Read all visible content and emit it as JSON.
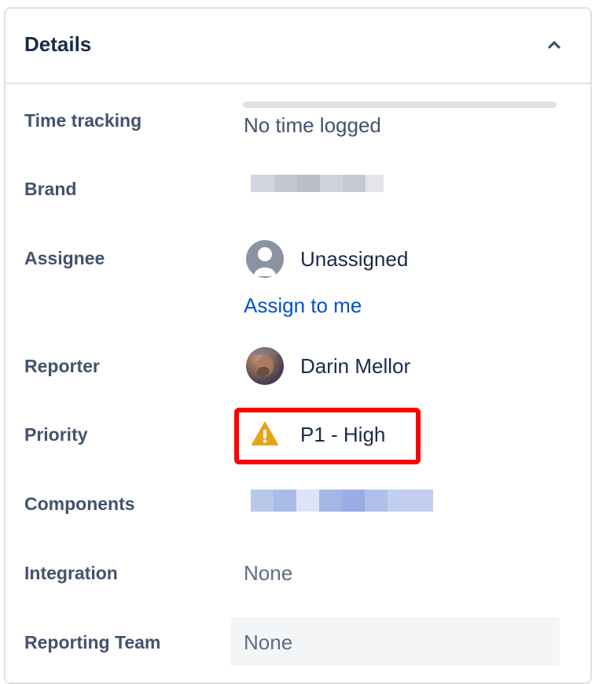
{
  "panel": {
    "title": "Details"
  },
  "fields": {
    "time_tracking": {
      "label": "Time tracking",
      "value": "No time logged"
    },
    "brand": {
      "label": "Brand"
    },
    "assignee": {
      "label": "Assignee",
      "value": "Unassigned",
      "action": "Assign to me"
    },
    "reporter": {
      "label": "Reporter",
      "value": "Darin Mellor"
    },
    "priority": {
      "label": "Priority",
      "value": "P1 - High"
    },
    "components": {
      "label": "Components"
    },
    "integration": {
      "label": "Integration",
      "value": "None"
    },
    "reporting_team": {
      "label": "Reporting Team",
      "value": "None"
    }
  },
  "colors": {
    "link": "#0052cc",
    "highlight": "#ff0000",
    "warning": "#e8a317"
  },
  "icons": {
    "collapse": "chevron-up-icon",
    "assignee_avatar": "user-avatar-icon",
    "priority": "warning-triangle-icon"
  }
}
